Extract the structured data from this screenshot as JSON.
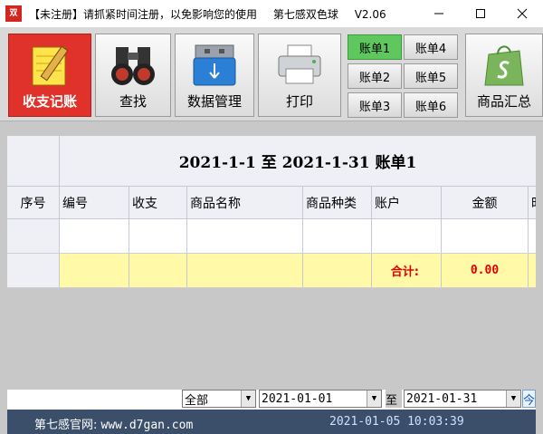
{
  "window": {
    "title": "【未注册】请抓紧时间注册，以免影响您的使用",
    "app_name": "第七感双色球",
    "version": "V2.06",
    "icon_text": "双"
  },
  "toolbar": {
    "items": [
      {
        "label": "收支记账",
        "icon": "notepad-pencil-icon"
      },
      {
        "label": "查找",
        "icon": "binoculars-icon"
      },
      {
        "label": "数据管理",
        "icon": "usb-drive-icon"
      },
      {
        "label": "打印",
        "icon": "printer-icon"
      }
    ],
    "accounts": [
      "账单1",
      "账单4",
      "账单2",
      "账单5",
      "账单3",
      "账单6"
    ],
    "selected_account": "账单1",
    "summary": {
      "label": "商品汇总",
      "icon": "shopify-bag-icon"
    }
  },
  "report": {
    "title": "2021-1-1  至  2021-1-31  账单1",
    "columns": [
      "序号",
      "编号",
      "收支",
      "商品名称",
      "商品种类",
      "账户",
      "金额",
      "时"
    ],
    "total_label": "合计:",
    "total_value": "0.00"
  },
  "filter": {
    "type_value": "全部",
    "date_from": "2021-01-01",
    "to_label": "至",
    "date_to": "2021-01-31",
    "today_label": "今"
  },
  "status": {
    "site_label": "第七感官网:",
    "site_url": "www.d7gan.com",
    "datetime": "2021-01-05 10:03:39"
  },
  "colors": {
    "active_tool": "#e0312a",
    "selected_account": "#5ec85e",
    "total_row": "#fff9a8",
    "status_bar": "#3c4f6a"
  }
}
